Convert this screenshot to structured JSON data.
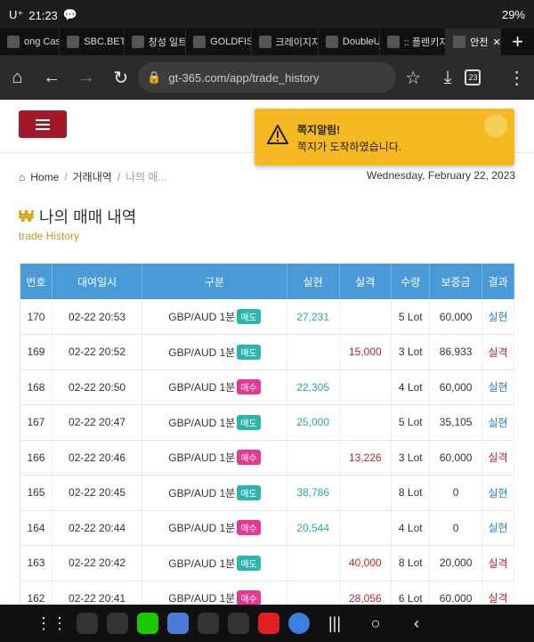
{
  "statusbar": {
    "carrier": "U⁺",
    "time": "21:23",
    "battery": "29%"
  },
  "tabs": [
    {
      "label": "ong Cas",
      "icon": "tab-icon"
    },
    {
      "label": "SBC.BET",
      "icon": "S"
    },
    {
      "label": "창성 일트",
      "icon": "crown"
    },
    {
      "label": "GOLDFIS",
      "icon": "fish"
    },
    {
      "label": "크레이지지",
      "icon": "globe"
    },
    {
      "label": "DoubleU",
      "icon": "D"
    },
    {
      "label": ":: 플렌키지",
      "icon": "VP"
    },
    {
      "label": "안전",
      "icon": "globe"
    }
  ],
  "browser": {
    "url": "gt-365.com/app/trade_history",
    "tab_count": "23"
  },
  "breadcrumb": {
    "home": "Home",
    "section": "거래내역",
    "current": "나의 매..."
  },
  "date": "Wednesday, February 22, 2023",
  "page": {
    "title": "나의 매매 내역",
    "currency_symbol": "₩",
    "subtitle": "trade History"
  },
  "toast": {
    "title": "쪽지알림!",
    "message": "쪽지가 도착하였습니다."
  },
  "table": {
    "headers": [
      "번호",
      "대여일시",
      "구분",
      "실현",
      "실격",
      "수량",
      "보증금",
      "결과"
    ],
    "rows": [
      {
        "no": "170",
        "time": "02-22 20:53",
        "pair": "GBP/AUD 1분",
        "type": "매도",
        "win": "27,231",
        "loss": "",
        "qty": "5 Lot",
        "deposit": "60,000",
        "result": "실현"
      },
      {
        "no": "169",
        "time": "02-22 20:52",
        "pair": "GBP/AUD 1분",
        "type": "매도",
        "win": "",
        "loss": "15,000",
        "qty": "3 Lot",
        "deposit": "86,933",
        "result": "실격"
      },
      {
        "no": "168",
        "time": "02-22 20:50",
        "pair": "GBP/AUD 1분",
        "type": "매수",
        "win": "22,305",
        "loss": "",
        "qty": "4 Lot",
        "deposit": "60,000",
        "result": "실현"
      },
      {
        "no": "167",
        "time": "02-22 20:47",
        "pair": "GBP/AUD 1분",
        "type": "매도",
        "win": "25,000",
        "loss": "",
        "qty": "5 Lot",
        "deposit": "35,105",
        "result": "실현"
      },
      {
        "no": "166",
        "time": "02-22 20:46",
        "pair": "GBP/AUD 1분",
        "type": "매수",
        "win": "",
        "loss": "13,226",
        "qty": "3 Lot",
        "deposit": "60,000",
        "result": "실격"
      },
      {
        "no": "165",
        "time": "02-22 20:45",
        "pair": "GBP/AUD 1분",
        "type": "매도",
        "win": "38,786",
        "loss": "",
        "qty": "8 Lot",
        "deposit": "0",
        "result": "실현"
      },
      {
        "no": "164",
        "time": "02-22 20:44",
        "pair": "GBP/AUD 1분",
        "type": "매수",
        "win": "20,544",
        "loss": "",
        "qty": "4 Lot",
        "deposit": "0",
        "result": "실현"
      },
      {
        "no": "163",
        "time": "02-22 20:42",
        "pair": "GBP/AUD 1분",
        "type": "매도",
        "win": "",
        "loss": "40,000",
        "qty": "8 Lot",
        "deposit": "20,000",
        "result": "실격"
      },
      {
        "no": "162",
        "time": "02-22 20:41",
        "pair": "GBP/AUD 1분",
        "type": "매수",
        "win": "",
        "loss": "28,056",
        "qty": "6 Lot",
        "deposit": "60,000",
        "result": "실격"
      }
    ]
  },
  "colors": {
    "sell_badge": "#2bb5ad",
    "buy_badge": "#e5388f",
    "win": "#28a9a1",
    "loss": "#c0242a",
    "header": "#4a9ad8",
    "menu": "#a0182a",
    "toast": "#f6b922"
  }
}
